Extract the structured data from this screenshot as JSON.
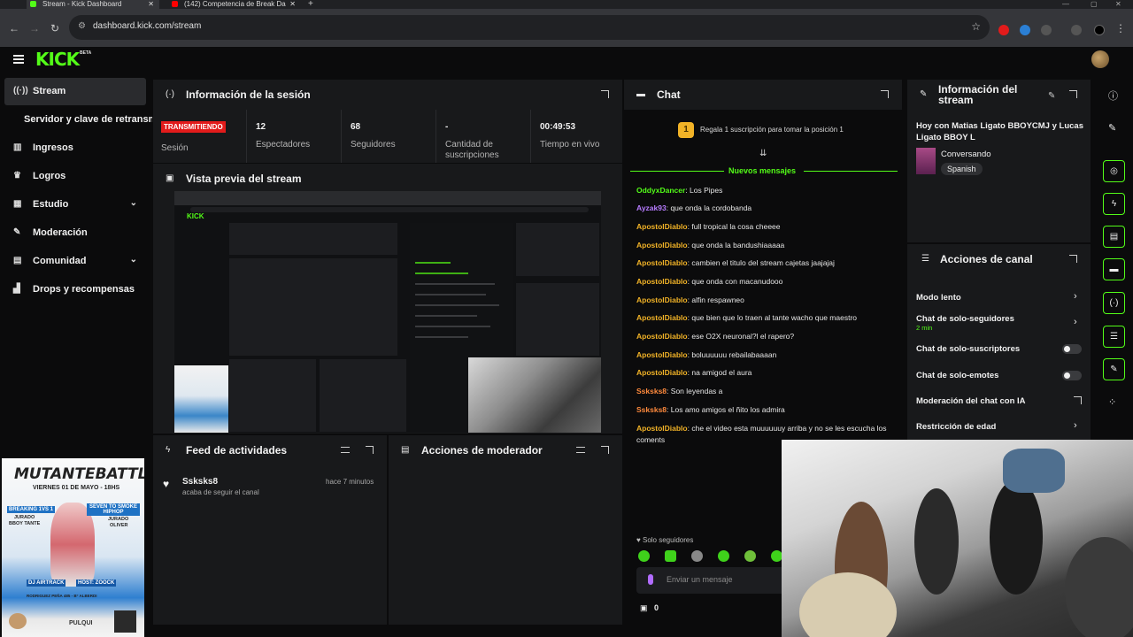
{
  "browser": {
    "tabs": [
      {
        "label": "Stream - Kick Dashboard"
      },
      {
        "label": "(142) Competencia de Break Da"
      }
    ],
    "url": "dashboard.kick.com/stream"
  },
  "brand": {
    "logo": "KICK",
    "beta": "BETA",
    "accent": "#53fc18"
  },
  "sidebar": {
    "items": [
      {
        "label": "Stream",
        "icon": "broadcast-icon"
      },
      {
        "label": "Servidor y clave de retransmisión"
      },
      {
        "label": "Ingresos",
        "icon": "chart-icon"
      },
      {
        "label": "Logros",
        "icon": "trophy-icon"
      },
      {
        "label": "Estudio",
        "icon": "studio-icon"
      },
      {
        "label": "Moderación",
        "icon": "wrench-icon"
      },
      {
        "label": "Comunidad",
        "icon": "community-icon"
      },
      {
        "label": "Drops y recompensas",
        "icon": "gift-icon"
      }
    ]
  },
  "session": {
    "title": "Información de la sesión",
    "status": "TRANSMITIENDO",
    "status_label": "Sesión",
    "stats": [
      {
        "value": "12",
        "label": "Espectadores"
      },
      {
        "value": "68",
        "label": "Seguidores"
      },
      {
        "value": "-",
        "label": "Cantidad de suscripciones"
      },
      {
        "value": "00:49:53",
        "label": "Tiempo en vivo"
      }
    ]
  },
  "preview": {
    "title": "Vista previa del stream"
  },
  "activity": {
    "title": "Feed de actividades",
    "items": [
      {
        "user": "Ssksks8",
        "desc": "acaba de seguir el canal",
        "time": "hace 7 minutos"
      }
    ]
  },
  "mod_actions": {
    "title": "Acciones de moderador"
  },
  "chat": {
    "title": "Chat",
    "gift_rank": "1",
    "gift_text": "Regala 1 suscripción para tomar la posición 1",
    "new_messages": "Nuevos mensajes",
    "messages": [
      {
        "user": "OddyxDancer",
        "text": "Los Pipes",
        "color": "#53fc18"
      },
      {
        "user": "Ayzak93",
        "text": "que onda la cordobanda",
        "color": "#b77cff"
      },
      {
        "user": "ApostolDiablo",
        "text": "full tropical la cosa cheeee",
        "color": "#f2b327"
      },
      {
        "user": "ApostolDiablo",
        "text": "que onda la bandushiaaaaa",
        "color": "#f2b327"
      },
      {
        "user": "ApostolDiablo",
        "text": "cambien el titulo del stream cajetas jaajajaj",
        "color": "#f2b327"
      },
      {
        "user": "ApostolDiablo",
        "text": "que onda con macanudooo",
        "color": "#f2b327"
      },
      {
        "user": "ApostolDiablo",
        "text": "alfin respawneo",
        "color": "#f2b327"
      },
      {
        "user": "ApostolDiablo",
        "text": "que bien que lo traen al tante wacho que maestro",
        "color": "#f2b327"
      },
      {
        "user": "ApostolDiablo",
        "text": "ese O2X neuronal?l el rapero?",
        "color": "#f2b327"
      },
      {
        "user": "ApostolDiablo",
        "text": "boluuuuuu rebailabaaaan",
        "color": "#f2b327"
      },
      {
        "user": "ApostolDiablo",
        "text": "na amigod el aura",
        "color": "#f2b327"
      },
      {
        "user": "Ssksks8",
        "text": "Son leyendas a",
        "color": "#ff8a3d"
      },
      {
        "user": "Ssksks8",
        "text": "Los amo amigos el ñito los admira",
        "color": "#ff8a3d"
      },
      {
        "user": "ApostolDiablo",
        "text": "che el video esta muuuuuuy arriba y no se les escucha los coments",
        "color": "#f2b327"
      }
    ],
    "followers_only": "Solo seguidores",
    "input_placeholder": "Enviar un mensaje",
    "points": "0"
  },
  "stream_info": {
    "title": "Información del stream",
    "description": "Hoy con Matias Ligato BBOYCMJ y Lucas Ligato BBOY L",
    "category": "Conversando",
    "language": "Spanish"
  },
  "channel_actions": {
    "title": "Acciones de canal",
    "items": [
      {
        "label": "Modo lento"
      },
      {
        "label": "Chat de solo-seguidores",
        "sub": "2 min"
      },
      {
        "label": "Chat de solo-suscriptores"
      },
      {
        "label": "Chat de solo-emotes"
      },
      {
        "label": "Moderación del chat con IA"
      },
      {
        "label": "Restricción de edad"
      }
    ]
  },
  "poster": {
    "title": "MUTANTEBATTLE",
    "date": "VIERNES 01 DE MAYO - 18HS",
    "tag1": "BREAKING 1VS 1",
    "tag2": "SEVEN TO SMOKE HIPHOP",
    "jurado1": "JURADO",
    "jurado1_name": "BBOY TANTE",
    "jurado2": "JURADO",
    "jurado2_name": "OLIVER",
    "dj": "DJ AIRTRACK",
    "host": "HOST: ZOOCK",
    "address": "RODRIGUEZ PEÑA 485 - B° ALBERDI",
    "brand": "PULQUI"
  }
}
